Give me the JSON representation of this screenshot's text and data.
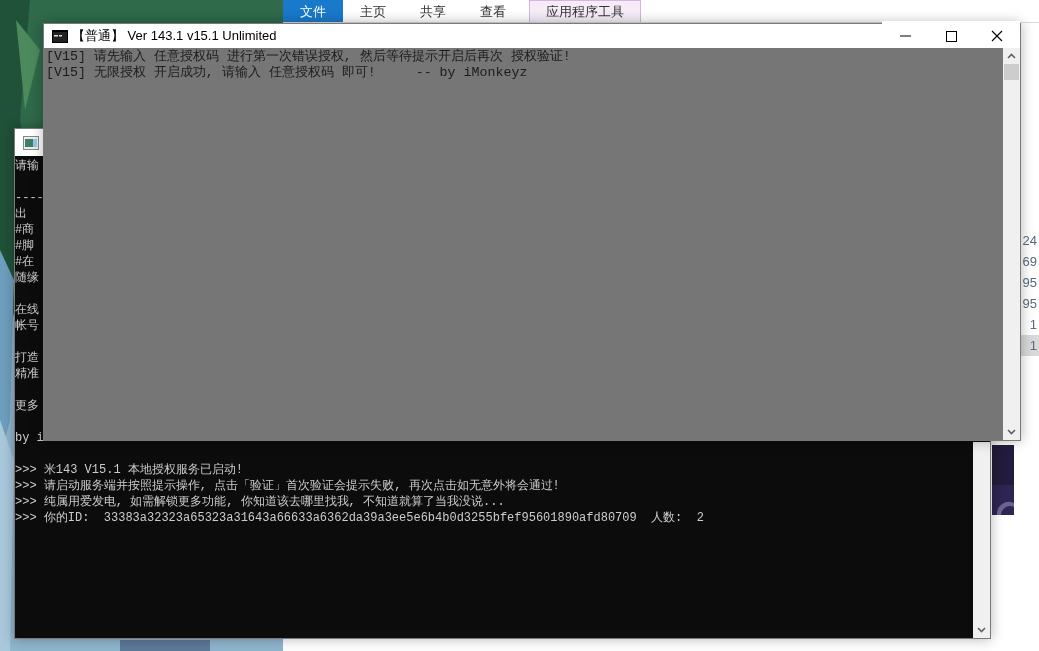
{
  "explorer": {
    "ribbon_tabs": [
      {
        "label": "文件",
        "selected": true,
        "kind": "normal"
      },
      {
        "label": "主页",
        "selected": false,
        "kind": "normal"
      },
      {
        "label": "共享",
        "selected": false,
        "kind": "normal"
      },
      {
        "label": "查看",
        "selected": false,
        "kind": "normal"
      },
      {
        "label": "应用程序工具",
        "selected": false,
        "kind": "contextual"
      }
    ],
    "column_values": [
      {
        "text": "24",
        "selected": false
      },
      {
        "text": "69",
        "selected": false
      },
      {
        "text": "95",
        "selected": false
      },
      {
        "text": "95",
        "selected": false
      },
      {
        "text": "1",
        "selected": false
      },
      {
        "text": "1",
        "selected": true
      }
    ]
  },
  "back_console": {
    "blocks": [
      [
        "请输"
      ],
      [
        "----",
        "出",
        "#商",
        "#脚",
        "#在",
        "随缘"
      ],
      [
        "在线",
        "帐号"
      ],
      [
        "打造",
        "精准"
      ],
      [
        "更多"
      ],
      [
        "by i"
      ],
      [
        ">>> 米143 V15.1 本地授权服务已启动!",
        ">>> 请启动服务端并按照提示操作, 点击「验证」首次验证会提示失败, 再次点击如无意外将会通过!",
        ">>> 纯属用爱发电, 如需解锁更多功能, 你知道该去哪里找我, 不知道就算了当我没说...",
        ">>> 你的ID:  33383a32323a65323a31643a66633a6362da39a3ee5e6b4b0d3255bfef95601890afd80709  人数:  2"
      ]
    ]
  },
  "front_console": {
    "title": "【普通】 Ver 143.1   v15.1 Unlimited",
    "lines": [
      "[V15] 请先输入 任意授权码 进行第一次错误授权, 然后等待提示开启后再次 授权验证!",
      "[V15] 无限授权 开启成功, 请输入 任意授权码 即可!     -- by iMonkeyz"
    ]
  }
}
